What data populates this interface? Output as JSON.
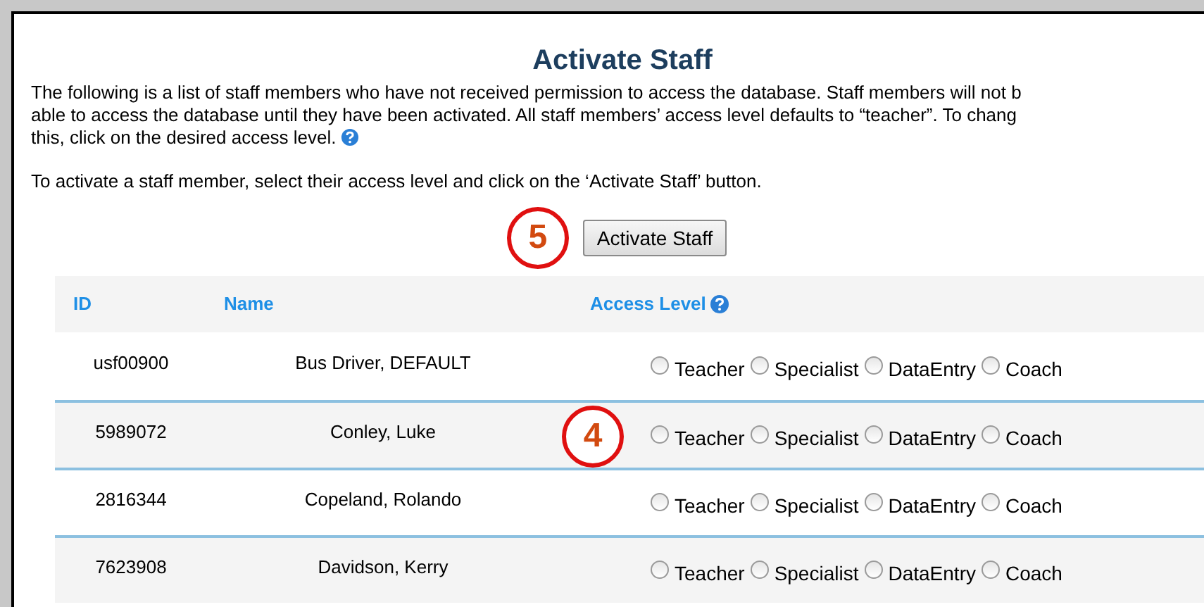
{
  "title": "Activate Staff",
  "intro": "The following is a list of staff members who have not received permission to access the database. Staff members will not b\nable to access the database until they have been activated. All staff members’ access level defaults to “teacher”. To chang\nthis, click on the desired access level.",
  "instruction": "To activate a staff member, select their access level and click on the ‘Activate Staff’ button.",
  "activate_button": {
    "label": "Activate Staff",
    "callout": "5"
  },
  "table": {
    "columns": [
      "ID",
      "Name",
      "Access Level"
    ],
    "rows": [
      {
        "id": "usf00900",
        "name": "Bus Driver, DEFAULT",
        "options": [
          {
            "label": "Teacher",
            "selected": false
          },
          {
            "label": "Specialist",
            "selected": false
          },
          {
            "label": "DataEntry",
            "selected": false
          },
          {
            "label": "Coach",
            "selected": false
          }
        ]
      },
      {
        "id": "5989072",
        "name": "Conley, Luke",
        "callout": "4",
        "options": [
          {
            "label": "Teacher",
            "selected": false
          },
          {
            "label": "Specialist",
            "selected": false
          },
          {
            "label": "DataEntry",
            "selected": false
          },
          {
            "label": "Coach",
            "selected": false
          }
        ]
      },
      {
        "id": "2816344",
        "name": "Copeland, Rolando",
        "options": [
          {
            "label": "Teacher",
            "selected": false
          },
          {
            "label": "Specialist",
            "selected": false
          },
          {
            "label": "DataEntry",
            "selected": false
          },
          {
            "label": "Coach",
            "selected": false
          }
        ]
      },
      {
        "id": "7623908",
        "name": "Davidson, Kerry",
        "options": [
          {
            "label": "Teacher",
            "selected": false
          },
          {
            "label": "Specialist",
            "selected": false
          },
          {
            "label": "DataEntry",
            "selected": false
          },
          {
            "label": "Coach",
            "selected": false
          }
        ]
      }
    ]
  }
}
